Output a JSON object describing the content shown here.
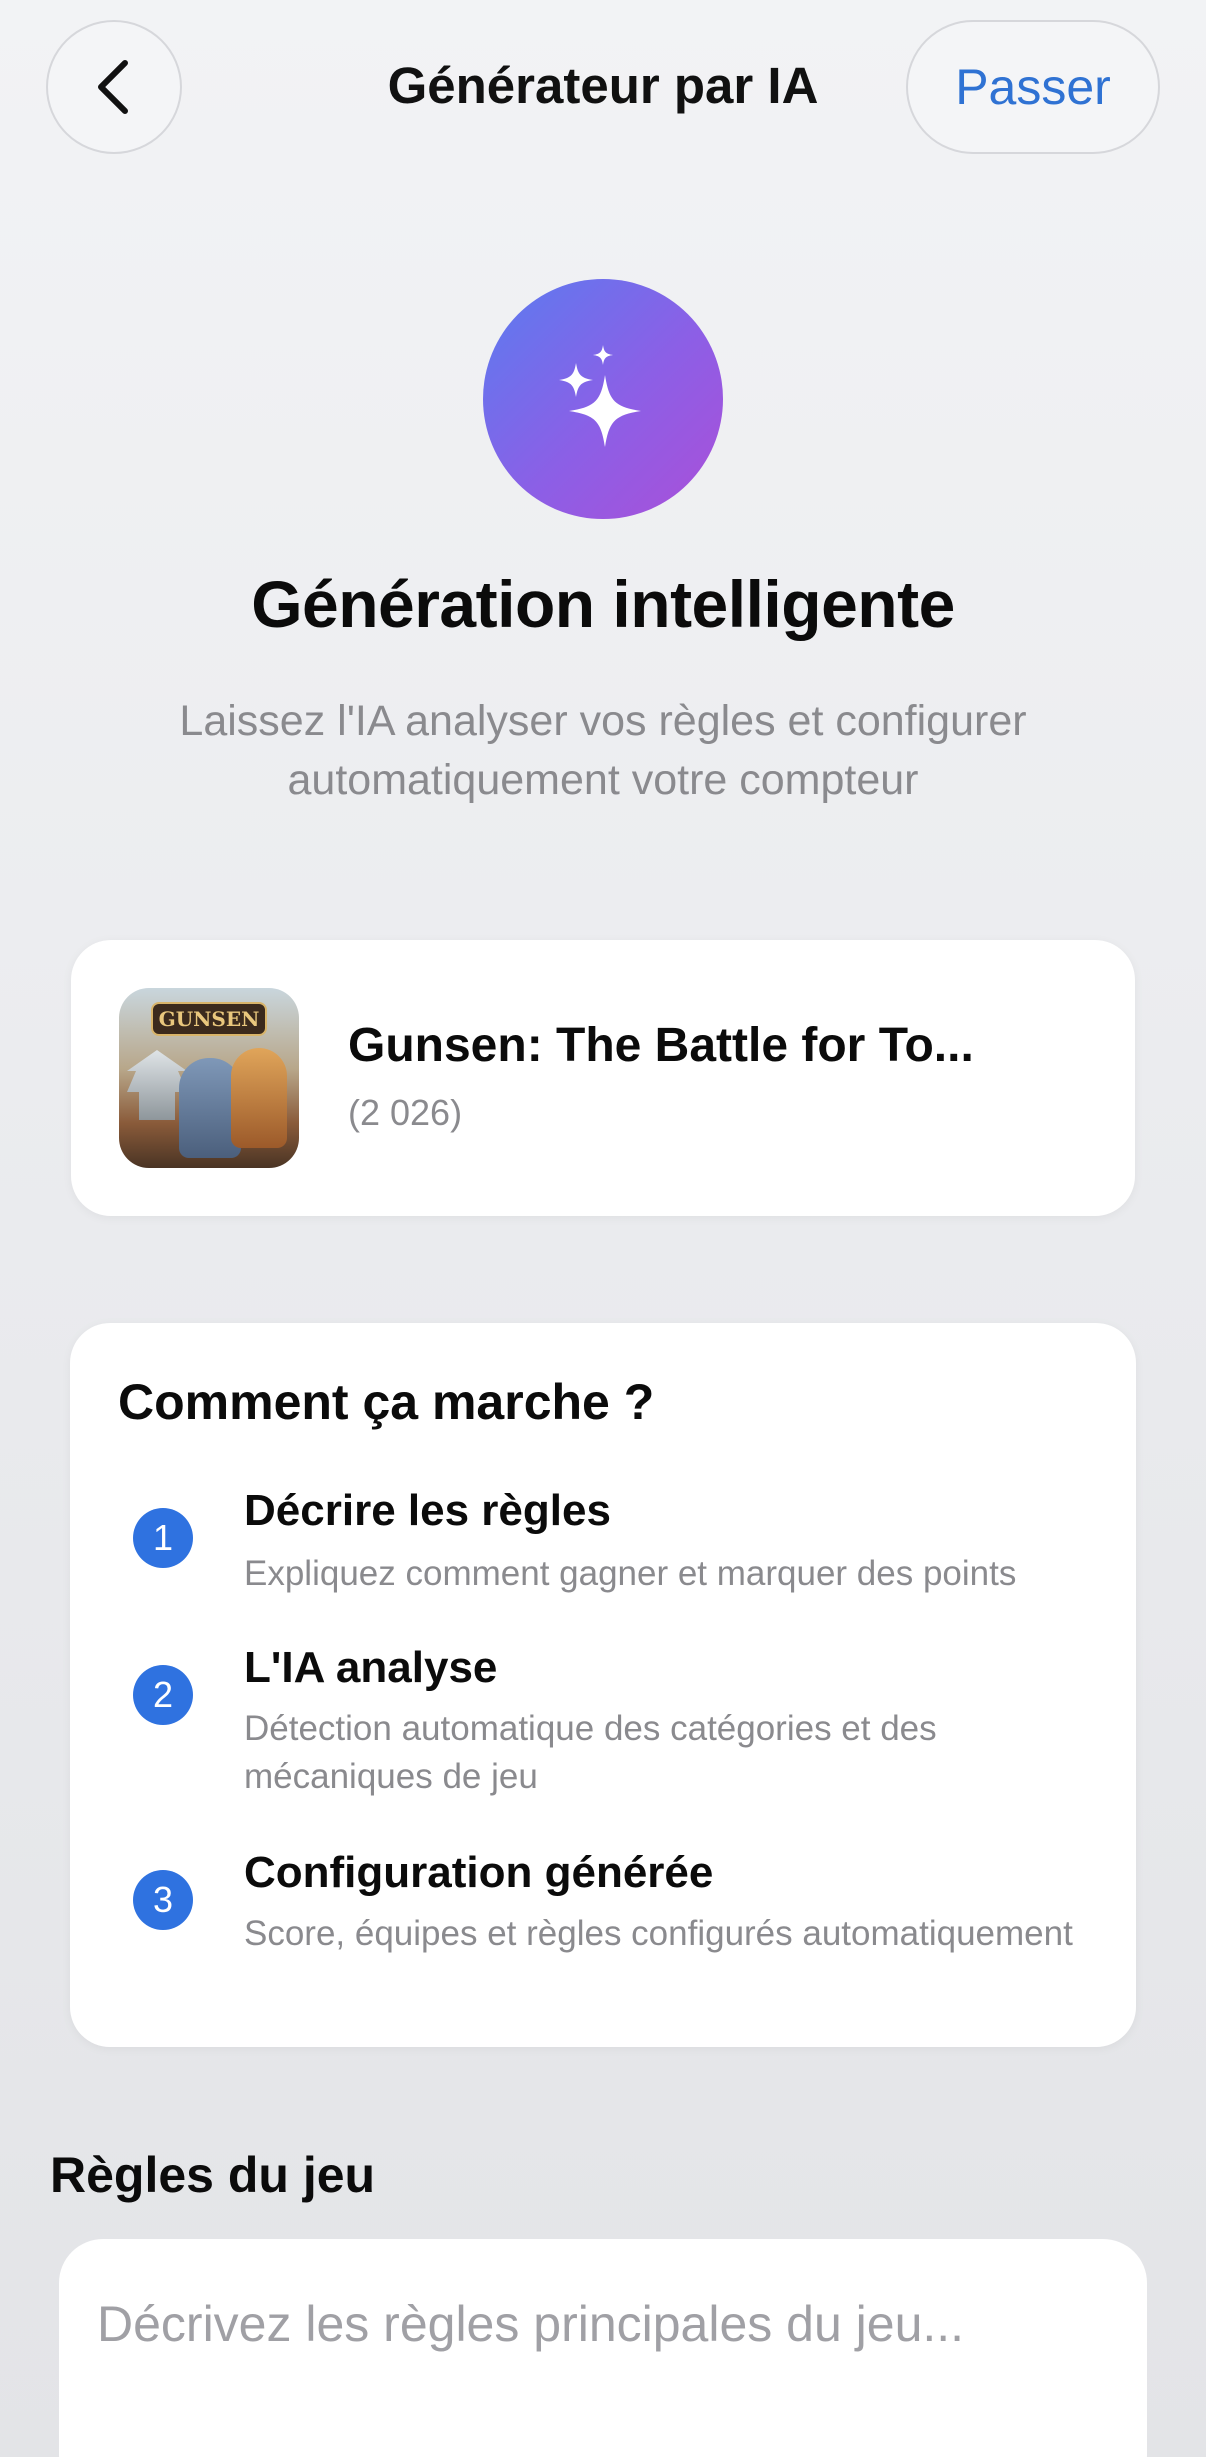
{
  "header": {
    "title": "Générateur par IA",
    "skip_label": "Passer"
  },
  "hero": {
    "icon": "sparkles-icon",
    "title": "Génération intelligente",
    "subtitle": "Laissez l'IA analyser vos règles et configurer automatiquement votre compteur"
  },
  "game": {
    "name": "Gunsen: The Battle for To...",
    "year": "(2 026)",
    "thumbnail_logo_text": "GUNSEN"
  },
  "how_it_works": {
    "title": "Comment ça marche ?",
    "steps": [
      {
        "number": "1",
        "title": "Décrire les règles",
        "description": "Expliquez comment gagner et marquer des points"
      },
      {
        "number": "2",
        "title": "L'IA analyse",
        "description": "Détection automatique des catégories et des mécaniques de jeu"
      },
      {
        "number": "3",
        "title": "Configuration générée",
        "description": "Score, équipes et règles configurés automatiquement"
      }
    ]
  },
  "rules": {
    "label": "Règles du jeu",
    "value": "",
    "placeholder": "Décrivez les règles principales du jeu..."
  },
  "colors": {
    "accent": "#2f72d3",
    "step_badge": "#2f72e0",
    "hero_gradient_start": "#5a7cf0",
    "hero_gradient_end": "#ab4fd8",
    "secondary_text": "#8a8a8e"
  }
}
